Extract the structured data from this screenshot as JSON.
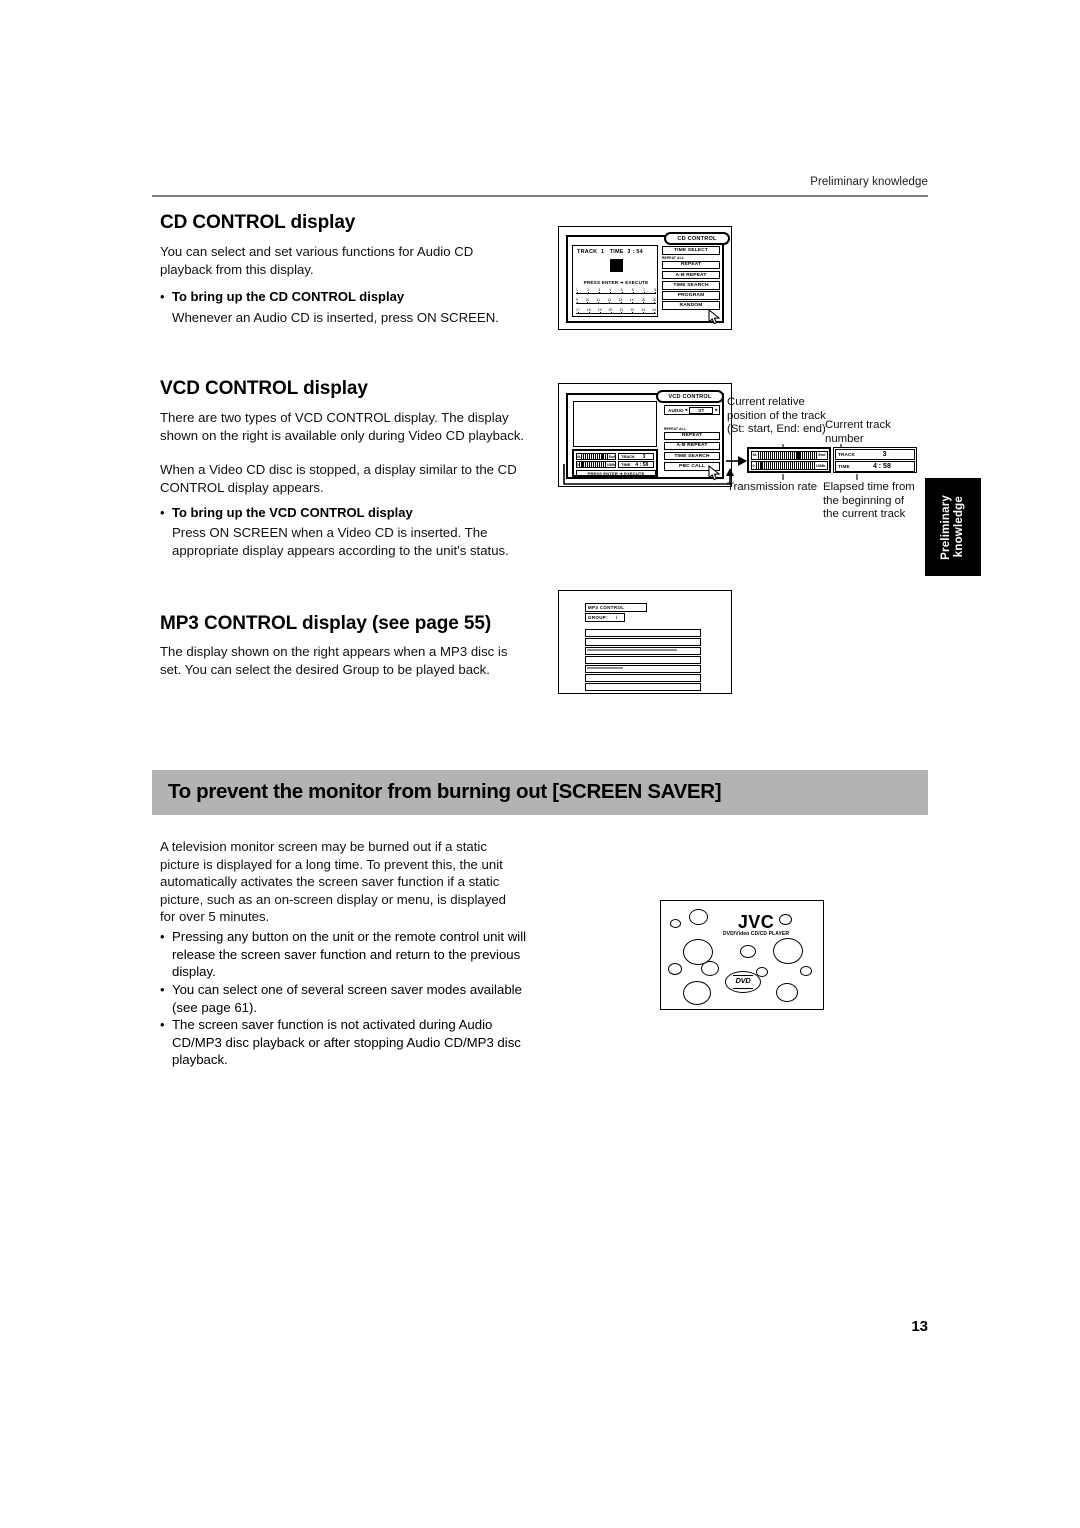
{
  "header": {
    "running_head": "Preliminary knowledge"
  },
  "page": {
    "number": "13"
  },
  "side_tab": {
    "line1": "Preliminary",
    "line2": "knowledge"
  },
  "sections": {
    "cd": {
      "heading": "CD CONTROL display",
      "intro": "You can select and set various functions for Audio CD playback from this display.",
      "bullet_title": "To bring up the CD CONTROL display",
      "bullet_body": "Whenever an Audio CD is inserted, press ON SCREEN."
    },
    "vcd": {
      "heading": "VCD CONTROL display",
      "intro_p1": "There are two types of VCD CONTROL display. The display shown on the right is available only during Video CD playback.",
      "intro_p2": "When a Video CD disc is stopped, a display similar to the CD CONTROL display appears.",
      "bullet_title": "To bring up the VCD CONTROL display",
      "bullet_body": "Press ON SCREEN when a Video CD is inserted. The appropriate display appears according to the unit's status."
    },
    "mp3": {
      "heading": "MP3 CONTROL display (see page 55)",
      "intro": "The display shown on the right appears when a MP3 disc is set. You can select the desired Group to be played back."
    },
    "screensaver": {
      "heading": "To prevent the monitor from burning out [SCREEN SAVER]",
      "intro": "A television monitor screen may be burned out if a static picture is displayed for a long time. To prevent this, the unit automatically activates the screen saver function if a static picture, such as an on-screen display or menu, is displayed for over 5 minutes.",
      "bullets": [
        "Pressing any button on the unit or the remote control unit will release the screen saver function and return to the previous display.",
        "You can select one of several screen saver modes available (see page 61).",
        "The screen saver function is not activated during Audio CD/MP3 disc playback or after stopping Audio CD/MP3 disc playback."
      ]
    }
  },
  "cd_osd": {
    "tab_label": "CD CONTROL",
    "track_label": "TRACK",
    "track_value": "1",
    "time_label": "TIME",
    "time_value": "3 : 54",
    "press_enter": "PRESS ENTER ➜ EXECUTE",
    "repeat_mini_label": "REPEAT ALL",
    "buttons": [
      "TIME SELECT",
      "REPEAT",
      "A-B REPEAT",
      "TIME SEARCH",
      "PROGRAM",
      "RANDOM"
    ],
    "track_rows": [
      [
        "1",
        "2",
        "3",
        "4",
        "5",
        "6",
        "7",
        "8"
      ],
      [
        "9",
        "10",
        "11",
        "12",
        "13",
        "14",
        "15",
        "16"
      ],
      [
        "17",
        "18",
        "19",
        "20",
        "21",
        "22",
        "23",
        "24"
      ]
    ]
  },
  "vcd_osd": {
    "tab_label": "VCD CONTROL",
    "audio_label": "AUDIO",
    "audio_value": "ST",
    "repeat_mini_label": "REPEAT ALL",
    "buttons": [
      "REPEAT",
      "A-B REPEAT",
      "TIME SEARCH",
      "PBC CALL"
    ],
    "track_label": "TRACK",
    "track_value": "3",
    "time_label": "TIME",
    "time_value": "4 : 58",
    "press_enter": "PRESS   ENTER ➜ EXECUTE",
    "position_start": "St.",
    "position_end": "End",
    "rate_min": "0",
    "rate_max": "10Mb"
  },
  "vcd_callouts": {
    "position": "Current relative position of the track (St: start, End: end)",
    "track_number": "Current track number",
    "transmission_rate": "Transmission rate",
    "elapsed": "Elapsed time from the beginning of the current track"
  },
  "mp3_osd": {
    "title": "MP3 CONTROL",
    "group_label": "GROUP:",
    "group_value": "/",
    "row_count": 7
  },
  "saver_image": {
    "logo": "JVC",
    "subtitle": "DVD/Video CD/CD PLAYER",
    "disc_badge": "DVD"
  }
}
